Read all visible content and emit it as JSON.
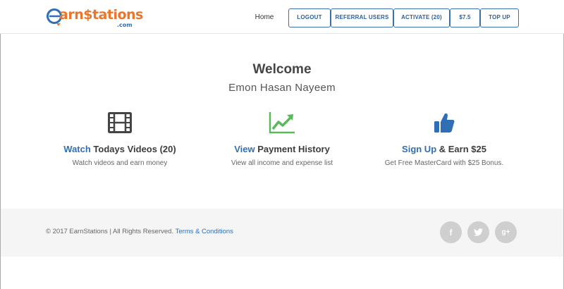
{
  "header": {
    "logo": {
      "part1": "e",
      "part2": "arn",
      "part3": "$",
      "part4": "tations",
      "suffix": ".com"
    },
    "nav": {
      "home": "Home",
      "logout": "LOGOUT",
      "referral": "REFERRAL USERS",
      "activate": "ACTIVATE (20)",
      "balance": "$7.5",
      "topup": "TOP UP"
    }
  },
  "main": {
    "welcome": "Welcome",
    "username": "Emon Hasan Nayeem",
    "features": [
      {
        "icon": "film-icon",
        "link": "Watch",
        "title": " Todays Videos (20)",
        "desc": "Watch videos and earn money"
      },
      {
        "icon": "chart-up-icon",
        "link": "View",
        "title": " Payment History",
        "desc": "View all income and expense list"
      },
      {
        "icon": "thumbs-up-icon",
        "link": "Sign Up",
        "title": " & Earn $25",
        "desc": "Get Free MasterCard with $25 Bonus."
      }
    ]
  },
  "footer": {
    "copyright": "© 2017 EarnStations | All Rights Reserved.",
    "terms": "Terms & Conditions",
    "social": [
      {
        "icon": "facebook-icon",
        "glyph": "f"
      },
      {
        "icon": "twitter-icon",
        "glyph": "t"
      },
      {
        "icon": "google-plus-icon",
        "glyph": "g+"
      }
    ]
  },
  "colors": {
    "brand_blue": "#2f6fb6",
    "brand_orange": "#e8762c",
    "icon_green": "#5cb85c",
    "footer_bg": "#f5f5f5"
  }
}
